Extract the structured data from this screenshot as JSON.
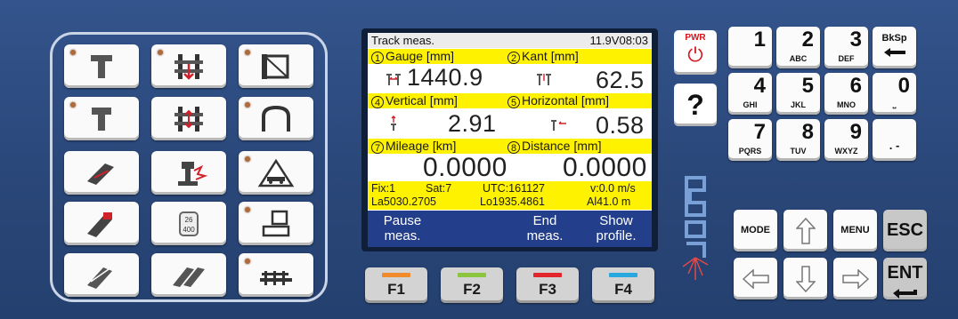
{
  "screen": {
    "title": "Track meas.",
    "status": "11.9V08:03",
    "f1_num": "1",
    "f1_label": "Gauge [mm]",
    "f2_num": "2",
    "f2_label": "Kant [mm]",
    "gauge_value": "1440.9",
    "kant_value": "62.5",
    "f4_num": "4",
    "f4_label": "Vertical [mm]",
    "f5_num": "5",
    "f5_label": "Horizontal [mm]",
    "vertical_value": "2.91",
    "horizontal_value": "0.58",
    "f7_num": "7",
    "f7_label": "Mileage [km]",
    "f8_num": "8",
    "f8_label": "Distance [mm]",
    "mileage_value": "0.0000",
    "distance_value": "0.0000",
    "gps": {
      "fix": "Fix:1",
      "sat": "Sat:7",
      "utc": "UTC:161127",
      "velocity": "v:0.0 m/s",
      "lat": "La5030.2705",
      "lon": "Lo1935.4861",
      "alt": "Al41.0 m"
    },
    "softkeys": {
      "sk1_line1": "Pause",
      "sk1_line2": "meas.",
      "sk3_line1": "End",
      "sk3_line2": "meas.",
      "sk4_line1": "Show",
      "sk4_line2": "profile."
    }
  },
  "fkeys": [
    {
      "label": "F1",
      "color": "#f08a2a"
    },
    {
      "label": "F2",
      "color": "#8cc63f"
    },
    {
      "label": "F3",
      "color": "#e3262b"
    },
    {
      "label": "F4",
      "color": "#29a8e0"
    }
  ],
  "power": {
    "label": "PWR",
    "symbol": "⏻"
  },
  "help_key": "?",
  "numpad": {
    "k1": {
      "digit": "1",
      "letters": ""
    },
    "k2": {
      "digit": "2",
      "letters": "ABC"
    },
    "k3": {
      "digit": "3",
      "letters": "DEF"
    },
    "bksp": "BkSp",
    "k4": {
      "digit": "4",
      "letters": "GHI"
    },
    "k5": {
      "digit": "5",
      "letters": "JKL"
    },
    "k6": {
      "digit": "6",
      "letters": "MNO"
    },
    "k0": {
      "digit": "0",
      "letters": "⎵"
    },
    "k7": {
      "digit": "7",
      "letters": "PQRS"
    },
    "k8": {
      "digit": "8",
      "letters": "TUV"
    },
    "k9": {
      "digit": "9",
      "letters": "WXYZ"
    },
    "kdot": ". -"
  },
  "nav": {
    "mode": "MODE",
    "menu": "MENU",
    "esc": "ESC",
    "ent": "ENT"
  },
  "icon_keys": [
    {
      "icon": "rail-profile-icon",
      "led": true
    },
    {
      "icon": "track-gauge-icon",
      "led": true
    },
    {
      "icon": "bridge-frame-icon",
      "led": true
    },
    {
      "icon": "rail-section-icon",
      "led": true
    },
    {
      "icon": "sleeper-defect-icon",
      "led": false
    },
    {
      "icon": "tunnel-clearance-icon",
      "led": true
    },
    {
      "icon": "rail-joint-icon",
      "led": false
    },
    {
      "icon": "rail-damage-icon",
      "led": false
    },
    {
      "icon": "level-crossing-sign-icon",
      "led": true
    },
    {
      "icon": "rail-fastening-icon",
      "led": false
    },
    {
      "icon": "speed-limit-sign-icon",
      "led": false,
      "badge_top": "26",
      "badge_bottom": "400"
    },
    {
      "icon": "signal-post-icon",
      "led": true
    },
    {
      "icon": "rail-weld-icon",
      "led": false
    },
    {
      "icon": "rail-switch-icon",
      "led": false
    },
    {
      "icon": "platform-edge-icon",
      "led": true
    }
  ]
}
